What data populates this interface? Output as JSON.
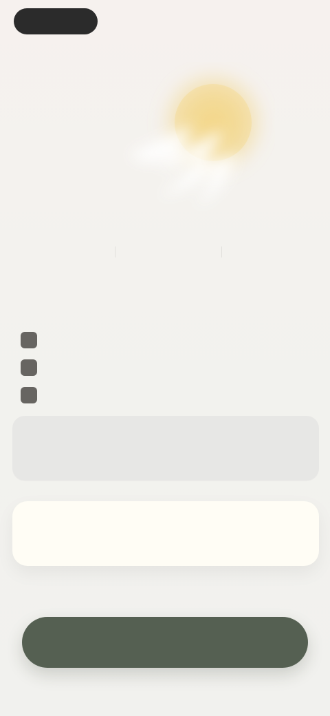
{
  "header": {
    "left_pill": "",
    "right_text": ""
  },
  "hero": {
    "sun_color": "#f2d27a",
    "bird_color": "#ffffff"
  },
  "metrics": [
    "",
    "",
    ""
  ],
  "section": {
    "title": ""
  },
  "bullets": [
    {
      "icon": "check-icon",
      "text": ""
    },
    {
      "icon": "check-icon",
      "text": ""
    },
    {
      "icon": "check-icon",
      "text": ""
    }
  ],
  "cards": [
    {
      "title": "",
      "subtitle": ""
    },
    {
      "title": "",
      "subtitle": ""
    }
  ],
  "fineprint": "",
  "cta": {
    "label": "",
    "color": "#556052"
  },
  "bottom_note": ""
}
